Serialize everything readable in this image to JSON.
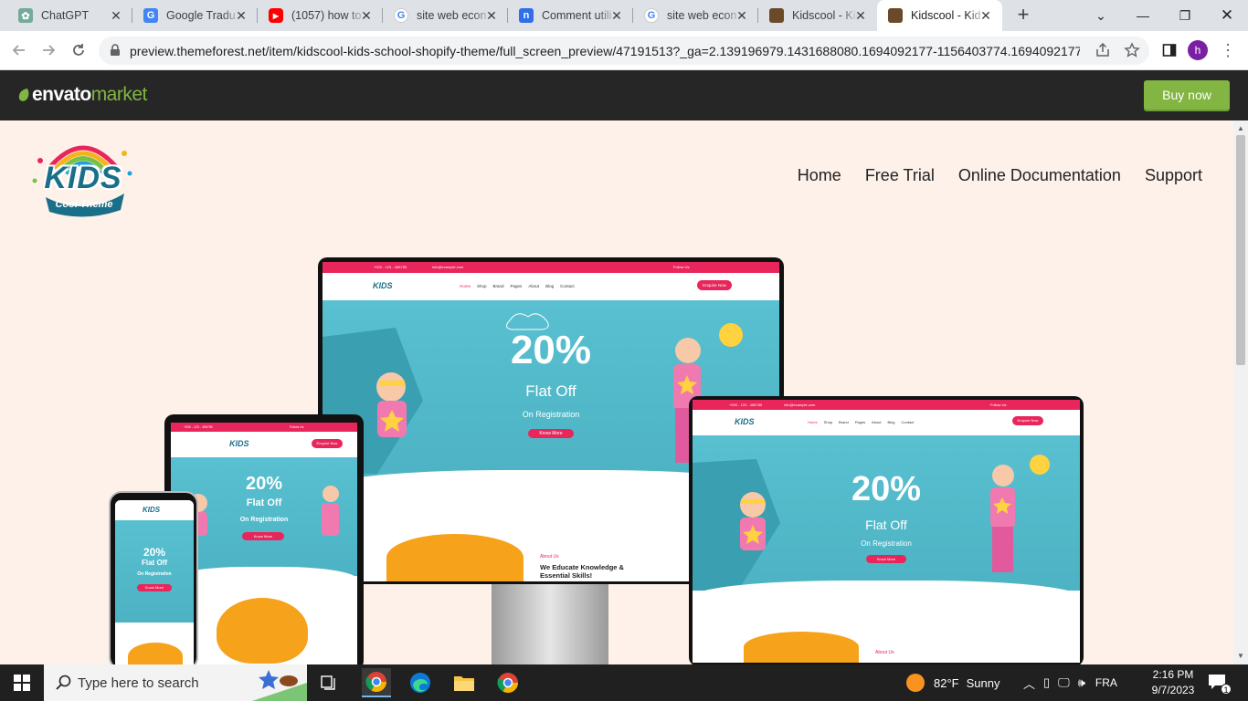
{
  "browser": {
    "tabs": [
      {
        "title": "ChatGPT",
        "icon": "chatgpt-icon",
        "color": "#74aa9c"
      },
      {
        "title": "Google Tradu",
        "icon": "google-translate-icon",
        "color": "#4285f4"
      },
      {
        "title": "(1057) how to",
        "icon": "youtube-icon",
        "color": "#ff0000"
      },
      {
        "title": "site web econ",
        "icon": "google-icon",
        "color": "#4285f4"
      },
      {
        "title": "Comment utili",
        "icon": "notion-n-icon",
        "color": "#2f6fed"
      },
      {
        "title": "site web econ",
        "icon": "google-icon",
        "color": "#4285f4"
      },
      {
        "title": "Kidscool - Kid",
        "icon": "kidscool-favicon",
        "color": "#6b4a2a"
      },
      {
        "title": "Kidscool - Kid",
        "icon": "kidscool-favicon",
        "color": "#6b4a2a"
      }
    ],
    "active_tab": 7,
    "url": "preview.themeforest.net/item/kidscool-kids-school-shopify-theme/full_screen_preview/47191513?_ga=2.139196979.1431688080.1694092177-1156403774.1694092177...",
    "profile_initial": "h"
  },
  "envato": {
    "logo_part1": "envato",
    "logo_part2": "market",
    "buy_now": "Buy now",
    "brand_green": "#82b541"
  },
  "site": {
    "logo_big": "KIDS",
    "logo_small": "Cool Theme",
    "nav": [
      "Home",
      "Free Trial",
      "Online Documentation",
      "Support"
    ]
  },
  "mockup": {
    "phone_contact": "+000 - 123 - 456789",
    "email": "info@example.com",
    "follow": "Follow Us",
    "menu": [
      "Home",
      "Shop",
      "Brand",
      "Pages",
      "About",
      "Blog",
      "Contact"
    ],
    "enquire": "Enquire Now",
    "headline": "20%",
    "subheadline": "Flat Off",
    "tagline": "On Registration",
    "cta": "Know More",
    "about_kicker": "About Us",
    "about_title": "We Educate Knowledge & Essential Skills!"
  },
  "taskbar": {
    "search_placeholder": "Type here to search",
    "weather_temp": "82°F",
    "weather_text": "Sunny",
    "language": "FRA",
    "time": "2:16 PM",
    "date": "9/7/2023",
    "notification_count": "1"
  }
}
